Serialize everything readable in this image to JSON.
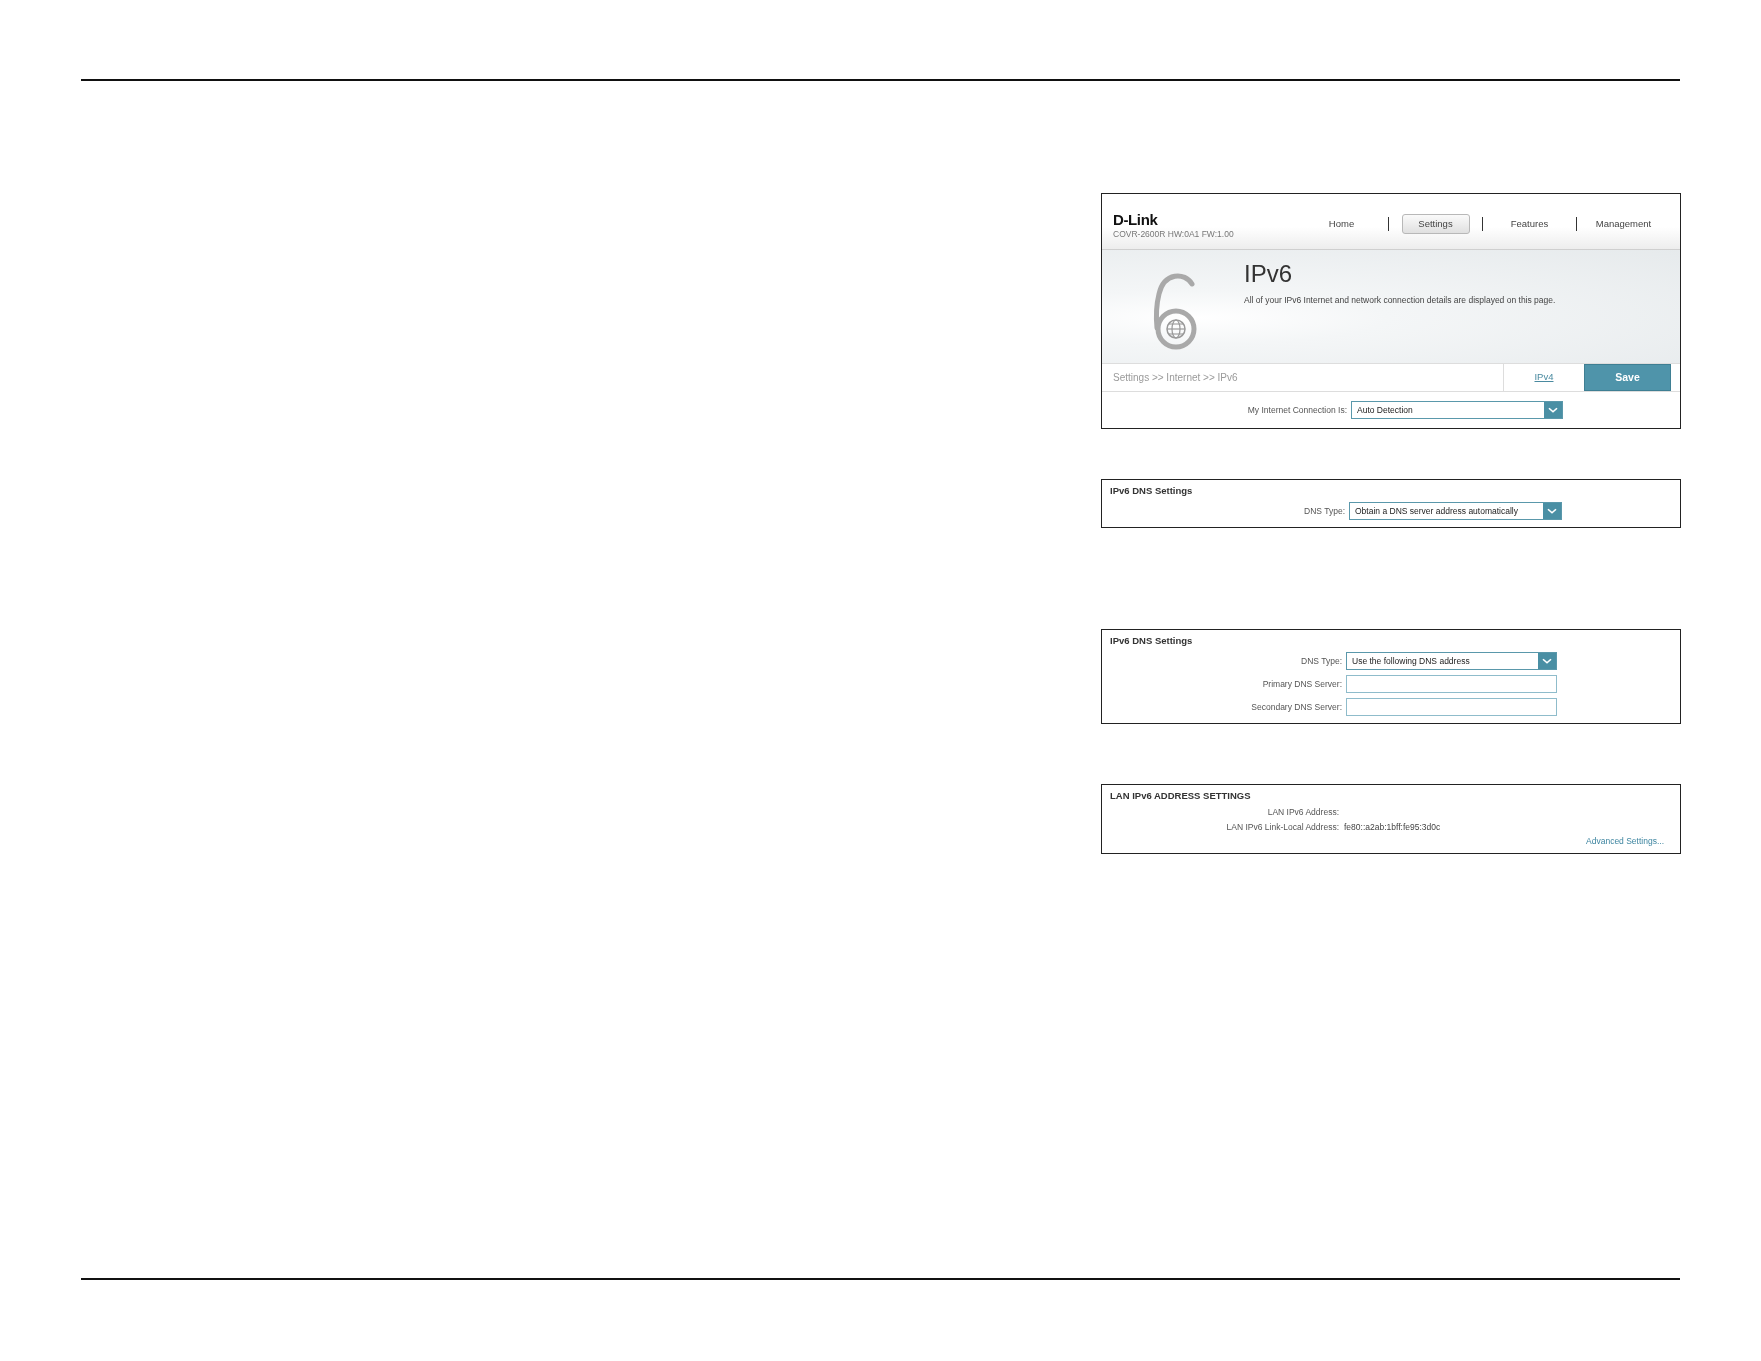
{
  "panels": [
    {
      "kind": "router_page",
      "logo": "D-Link",
      "model": "COVR-2600R HW:0A1 FW:1.00",
      "nav": [
        {
          "label": "Home",
          "selected": false
        },
        {
          "label": "Settings",
          "selected": true
        },
        {
          "label": "Features",
          "selected": false
        },
        {
          "label": "Management",
          "selected": false
        }
      ],
      "title": "IPv6",
      "description": "All of your IPv6 Internet and network connection details are displayed on this page.",
      "breadcrumb": "Settings >> Internet >> IPv6",
      "tab_link": "IPv4",
      "save_button": "Save",
      "fields": [
        {
          "kind": "select",
          "label": "My Internet Connection Is:",
          "value": "Auto Detection"
        }
      ]
    },
    {
      "kind": "section",
      "title": "IPv6 DNS Settings",
      "fields": [
        {
          "kind": "select",
          "label": "DNS Type:",
          "value": "Obtain a DNS server address automatically"
        }
      ]
    },
    {
      "kind": "section",
      "title": "IPv6 DNS Settings",
      "fields": [
        {
          "kind": "select",
          "label": "DNS Type:",
          "value": "Use the following DNS address"
        },
        {
          "kind": "input",
          "label": "Primary DNS Server:"
        },
        {
          "kind": "input",
          "label": "Secondary DNS Server:"
        }
      ]
    },
    {
      "kind": "section",
      "title": "LAN IPv6 ADDRESS SETTINGS",
      "fields": [
        {
          "kind": "text",
          "label": "LAN IPv6 Address:"
        },
        {
          "kind": "text",
          "label": "LAN IPv6 Link-Local Address:",
          "value": "fe80::a2ab:1bff:fe95:3d0c"
        }
      ],
      "link": "Advanced Settings..."
    }
  ]
}
